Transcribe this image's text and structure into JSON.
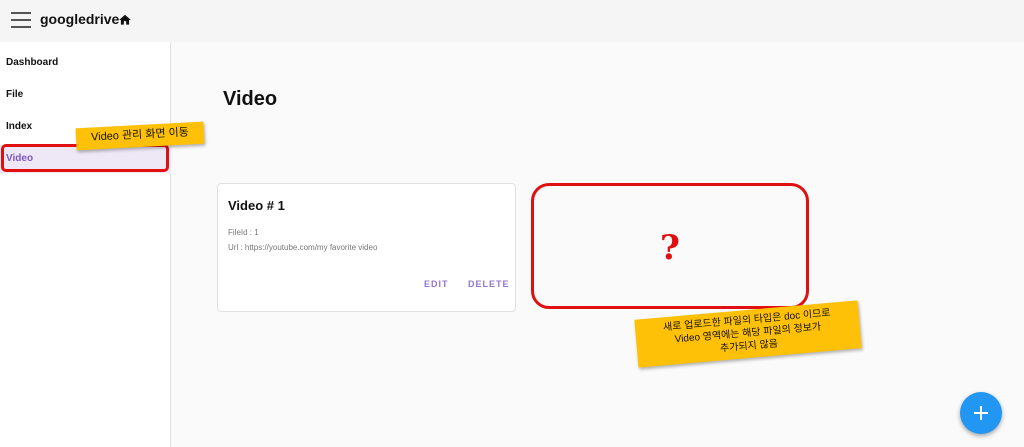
{
  "app": {
    "title": "googledrive"
  },
  "sidebar": {
    "items": [
      {
        "label": "Dashboard"
      },
      {
        "label": "File"
      },
      {
        "label": "Index"
      },
      {
        "label": "Video"
      }
    ]
  },
  "annotations": {
    "nav_note": "Video 관리 화면 이동",
    "missing_note_line1": "새로 업로드한 파일의 타입은 doc 이므로",
    "missing_note_line2": "Video 영역에는 해당 파일의 정보가",
    "missing_note_line3": "추가되지 않음",
    "question_mark": "?"
  },
  "main": {
    "title": "Video",
    "cards": [
      {
        "title": "Video # 1",
        "file_id": "FileId : 1",
        "url": "Url : https://youtube.com/my favorite video",
        "edit_label": "EDIT",
        "delete_label": "DELETE"
      }
    ]
  },
  "fab": {
    "icon": "plus-icon"
  },
  "colors": {
    "accent": "#7e57c2",
    "fab": "#2196f3",
    "highlight": "#e01010",
    "sticky": "#ffc107"
  }
}
